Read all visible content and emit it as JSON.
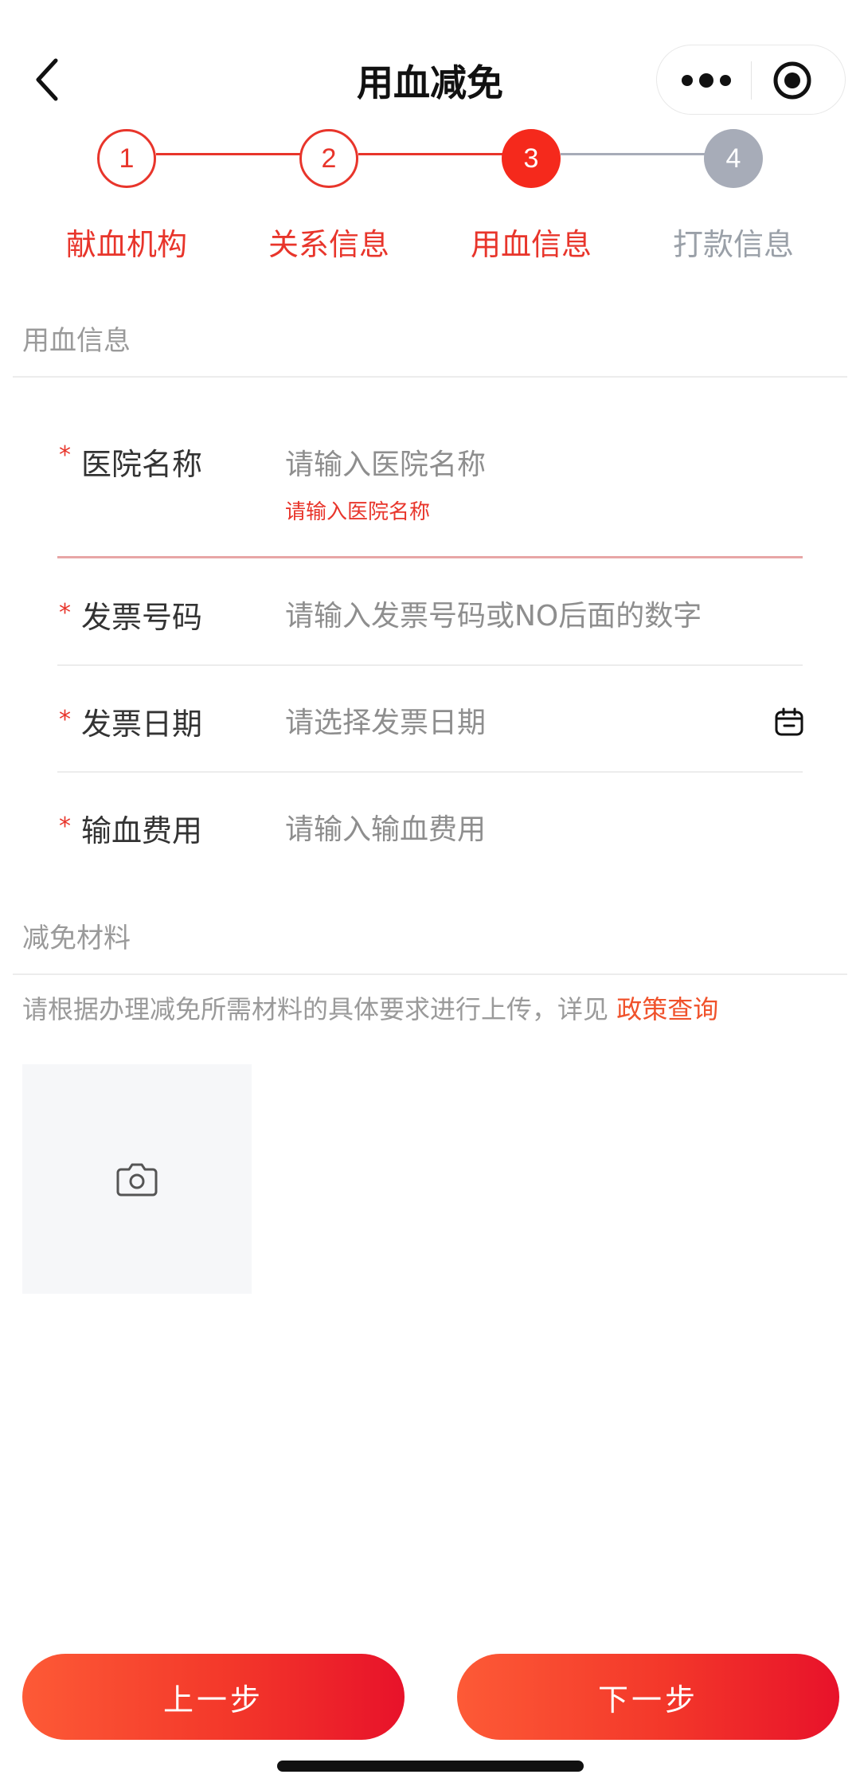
{
  "nav": {
    "title": "用血减免"
  },
  "stepper": {
    "steps": [
      {
        "number": "1",
        "label": "献血机构",
        "state": "done"
      },
      {
        "number": "2",
        "label": "关系信息",
        "state": "done"
      },
      {
        "number": "3",
        "label": "用血信息",
        "state": "active"
      },
      {
        "number": "4",
        "label": "打款信息",
        "state": "todo"
      }
    ]
  },
  "blood_info": {
    "section_title": "用血信息",
    "fields": [
      {
        "required_mark": "*",
        "label": "医院名称",
        "placeholder": "请输入医院名称",
        "value": "",
        "error": "请输入医院名称"
      },
      {
        "required_mark": "*",
        "label": "发票号码",
        "placeholder": "请输入发票号码或NO后面的数字",
        "value": ""
      },
      {
        "required_mark": "*",
        "label": "发票日期",
        "placeholder": "请选择发票日期",
        "value": "",
        "icon": "calendar-icon"
      },
      {
        "required_mark": "*",
        "label": "输血费用",
        "placeholder": "请输入输血费用",
        "value": ""
      }
    ]
  },
  "materials": {
    "section_title": "减免材料",
    "hint": "请根据办理减免所需材料的具体要求进行上传，详见",
    "hint_link": "政策查询",
    "upload_icon": "camera-icon"
  },
  "footer": {
    "prev_label": "上一步",
    "next_label": "下一步"
  },
  "colors": {
    "accent": "#e8352b",
    "inactive": "#a7acb8",
    "link": "#f0522b"
  }
}
